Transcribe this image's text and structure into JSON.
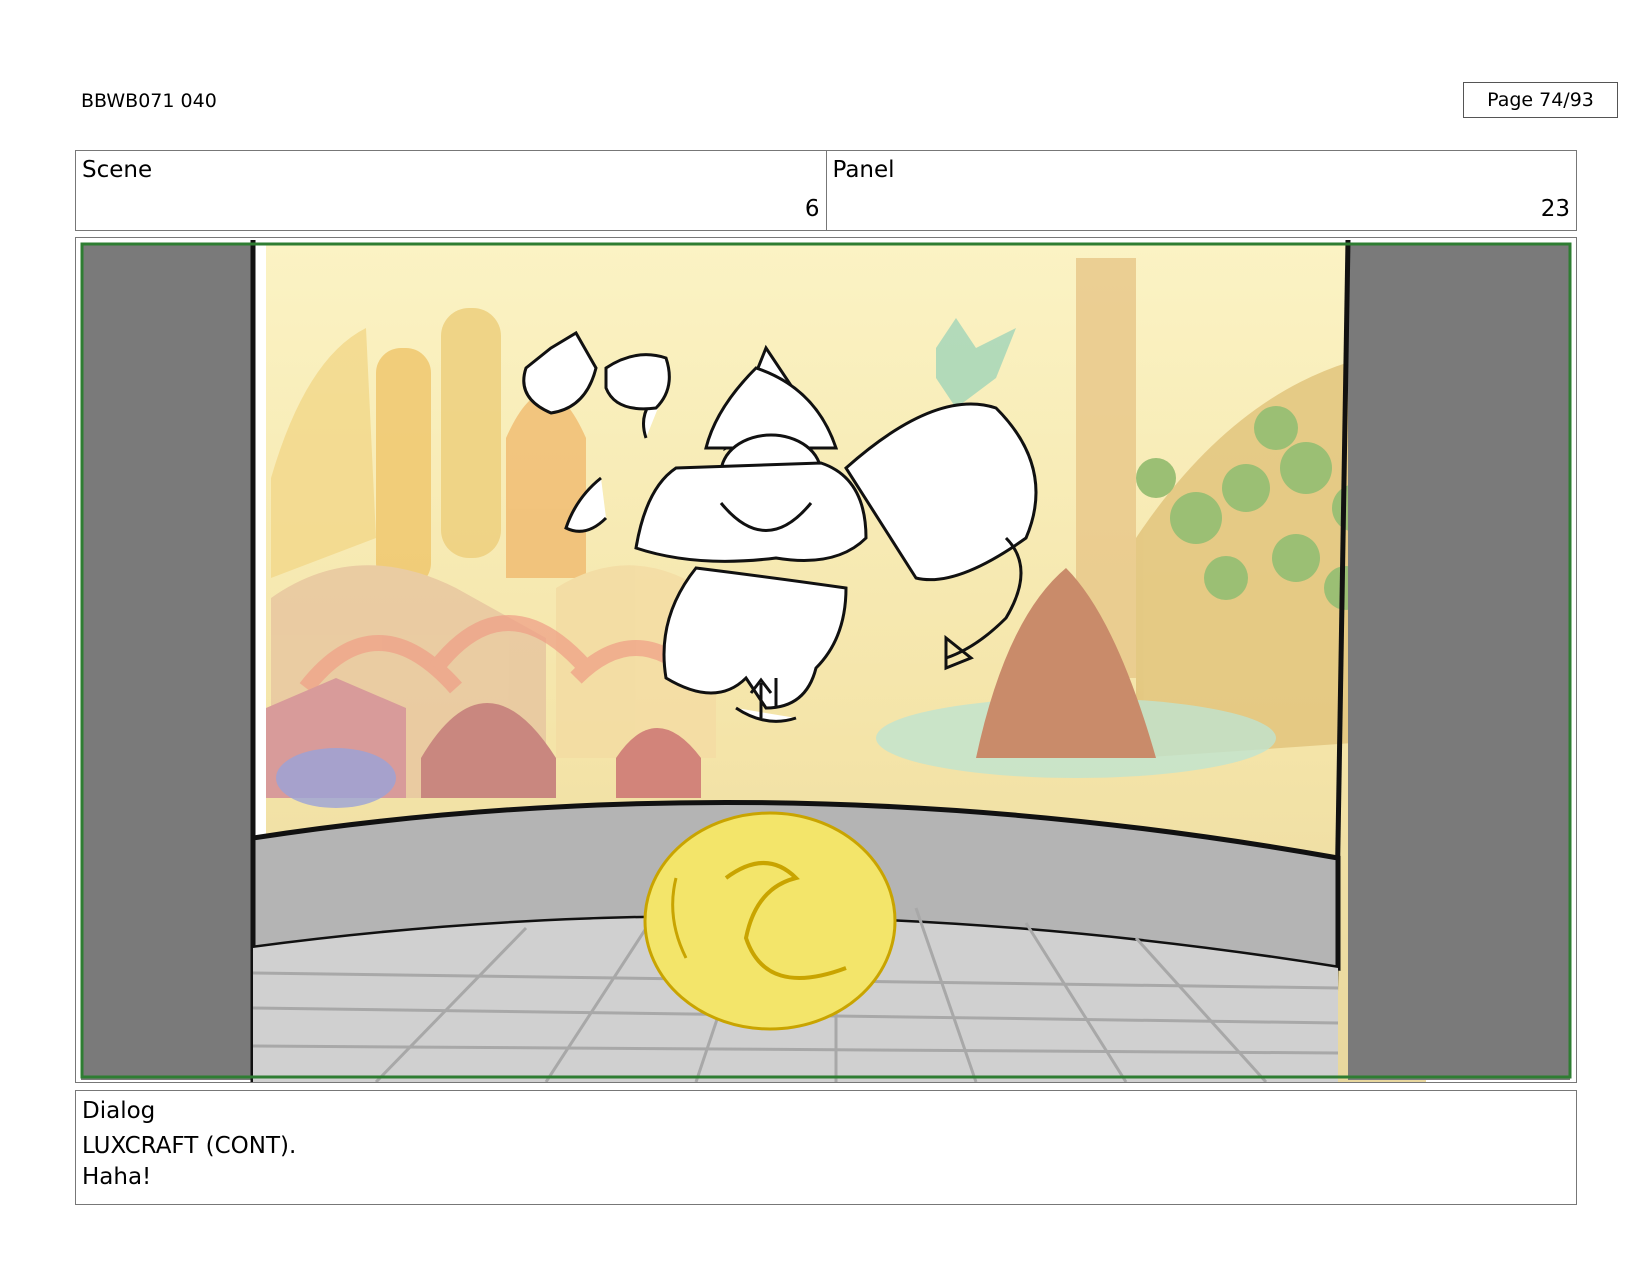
{
  "header": {
    "document_id": "BBWB071 040",
    "page_label": "Page 74/93"
  },
  "scene": {
    "label": "Scene",
    "value": "6"
  },
  "panel": {
    "label": "Panel",
    "value": "23"
  },
  "frame": {
    "description_icon": "storyboard-drawing",
    "colors": {
      "safe_area": "#2e7d32",
      "side_bars": "#7a7a7a",
      "wall": "#b4b4b4",
      "floor": "#d0d0d0",
      "orb": "#f3e56a",
      "orb_outline": "#c9a400"
    }
  },
  "dialog": {
    "label": "Dialog",
    "lines": [
      "LUXCRAFT (CONT).",
      "Haha!"
    ]
  }
}
